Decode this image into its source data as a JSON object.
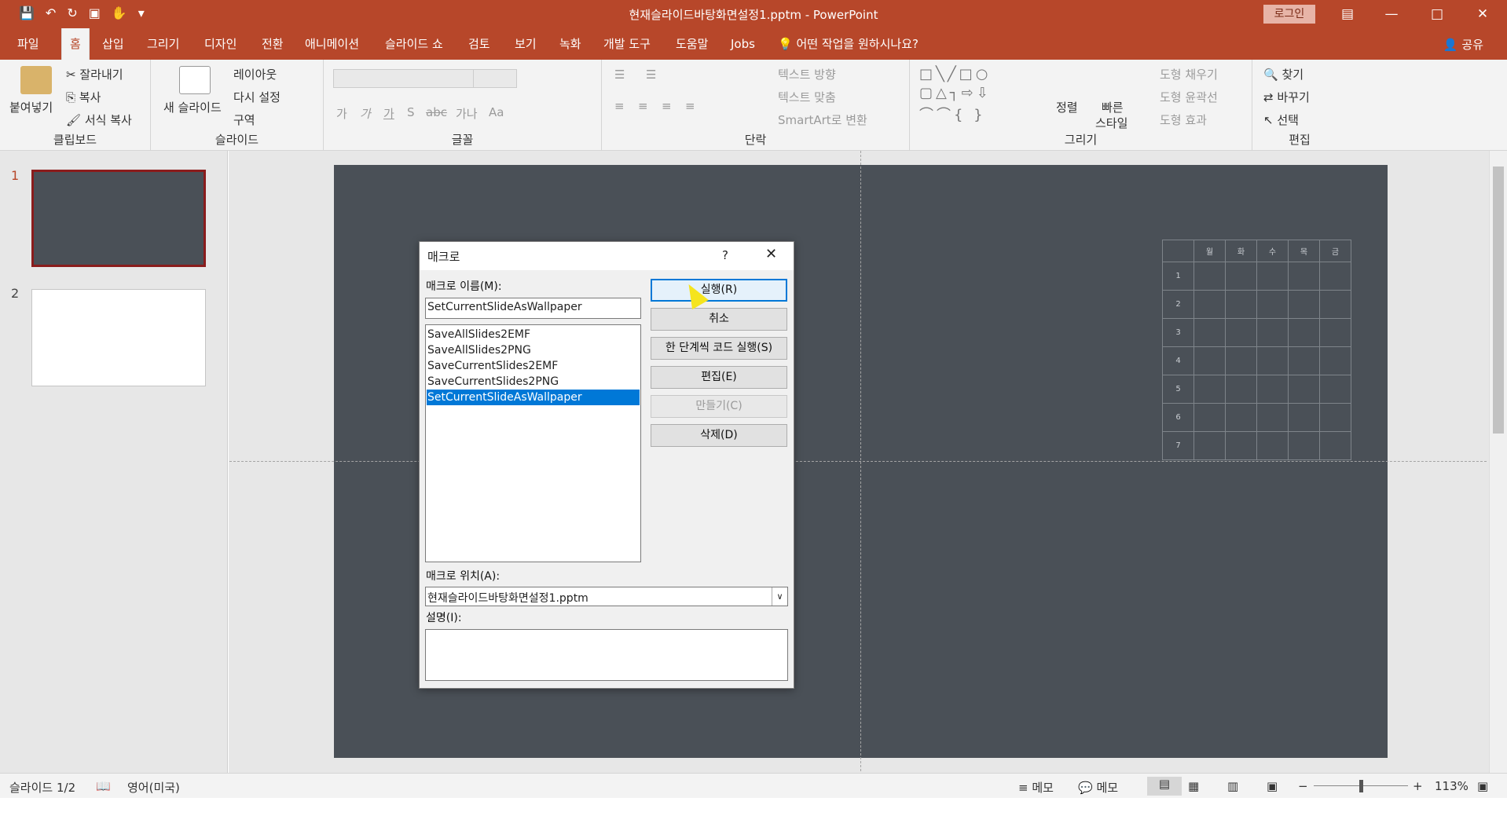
{
  "window": {
    "title": "현재슬라이드바탕화면설정1.pptm  -  PowerPoint",
    "login": "로그인",
    "qat_icons": [
      "save-icon",
      "undo-icon",
      "redo-icon",
      "present-icon",
      "touch-icon",
      "customize-icon"
    ]
  },
  "tabs": [
    "파일",
    "홈",
    "삽입",
    "그리기",
    "디자인",
    "전환",
    "애니메이션",
    "슬라이드 쇼",
    "검토",
    "보기",
    "녹화",
    "개발 도구",
    "도움말",
    "Jobs"
  ],
  "tellme": "어떤 작업을 원하시나요?",
  "share": "공유",
  "ribbon": {
    "clipboard": {
      "label": "클립보드",
      "paste": "붙여넣기",
      "cut": "잘라내기",
      "copy": "복사",
      "format_painter": "서식 복사"
    },
    "slides": {
      "label": "슬라이드",
      "new_slide": "새 슬라이드",
      "layout": "레이아웃",
      "reset": "다시 설정",
      "section": "구역"
    },
    "font": {
      "label": "글꼴",
      "bold": "가",
      "italic": "가",
      "underline": "가",
      "shadow": "S",
      "strike": "abc",
      "spacing": "가나",
      "case": "Aa"
    },
    "paragraph": {
      "label": "단락",
      "text_direction": "텍스트 방향",
      "align_text": "텍스트 맞춤",
      "smartart": "SmartArt로 변환"
    },
    "drawing": {
      "label": "그리기",
      "arrange": "정렬",
      "quick_styles_1": "빠른",
      "quick_styles_2": "스타일",
      "fill": "도형 채우기",
      "outline": "도형 윤곽선",
      "effects": "도형 효과"
    },
    "editing": {
      "label": "편집",
      "find": "찾기",
      "replace": "바꾸기",
      "select": "선택"
    }
  },
  "thumbnails": [
    {
      "num": "1"
    },
    {
      "num": "2"
    }
  ],
  "schedule": {
    "days": [
      "월",
      "화",
      "수",
      "목",
      "금"
    ],
    "rows": [
      "1",
      "2",
      "3",
      "4",
      "5",
      "6",
      "7"
    ]
  },
  "dialog": {
    "title": "매크로",
    "help": "?",
    "name_label": "매크로 이름(M):",
    "name_value": "SetCurrentSlideAsWallpaper",
    "macros": [
      "SaveAllSlides2EMF",
      "SaveAllSlides2PNG",
      "SaveCurrentSlides2EMF",
      "SaveCurrentSlides2PNG",
      "SetCurrentSlideAsWallpaper"
    ],
    "selected_index": 4,
    "buttons": {
      "run": "실행(R)",
      "cancel": "취소",
      "step": "한 단계씩 코드 실행(S)",
      "edit": "편집(E)",
      "create": "만들기(C)",
      "delete": "삭제(D)"
    },
    "location_label": "매크로 위치(A):",
    "location_value": "현재슬라이드바탕화면설정1.pptm",
    "desc_label": "설명(I):",
    "desc_value": ""
  },
  "status": {
    "slide": "슬라이드 1/2",
    "language": "영어(미국)",
    "notes": "메모",
    "comments": "메모",
    "zoom": "113%"
  }
}
